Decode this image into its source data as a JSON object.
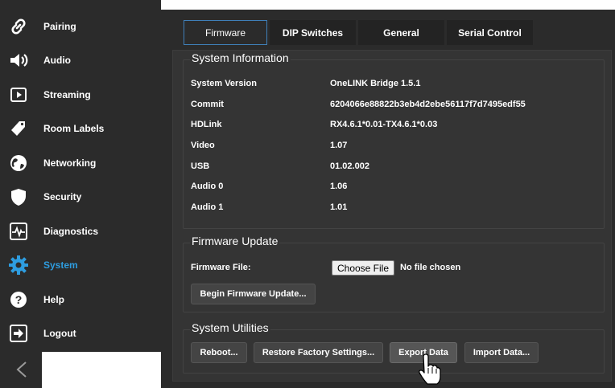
{
  "sidebar": {
    "items": [
      {
        "label": "Pairing",
        "icon": "link-icon"
      },
      {
        "label": "Audio",
        "icon": "speaker-icon"
      },
      {
        "label": "Streaming",
        "icon": "play-icon"
      },
      {
        "label": "Room Labels",
        "icon": "tag-icon"
      },
      {
        "label": "Networking",
        "icon": "globe-icon"
      },
      {
        "label": "Security",
        "icon": "shield-icon"
      },
      {
        "label": "Diagnostics",
        "icon": "pulse-icon"
      },
      {
        "label": "System",
        "icon": "gear-icon",
        "active": true
      },
      {
        "label": "Help",
        "icon": "help-icon"
      },
      {
        "label": "Logout",
        "icon": "logout-icon"
      }
    ],
    "collapse_icon": "chevron-left-icon"
  },
  "tabs": [
    {
      "label": "Firmware",
      "active": true
    },
    {
      "label": "DIP Switches"
    },
    {
      "label": "General"
    },
    {
      "label": "Serial Control"
    }
  ],
  "system_info": {
    "title": "System Information",
    "rows": [
      {
        "label": "System Version",
        "value": "OneLINK Bridge 1.5.1"
      },
      {
        "label": "Commit",
        "value": "6204066e88822b3eb4d2ebe56117f7d7495edf55"
      },
      {
        "label": "HDLink",
        "value": "RX4.6.1*0.01-TX4.6.1*0.03"
      },
      {
        "label": "Video",
        "value": "1.07"
      },
      {
        "label": "USB",
        "value": "01.02.002"
      },
      {
        "label": "Audio 0",
        "value": "1.06"
      },
      {
        "label": "Audio 1",
        "value": "1.01"
      }
    ]
  },
  "firmware_update": {
    "title": "Firmware Update",
    "file_label": "Firmware File:",
    "choose_button": "Choose File",
    "file_status": "No file chosen",
    "begin_button": "Begin Firmware Update..."
  },
  "utilities": {
    "title": "System Utilities",
    "buttons": [
      "Reboot...",
      "Restore Factory Settings...",
      "Export Data",
      "Import Data..."
    ]
  },
  "colors": {
    "accent": "#2e9de0",
    "sidebar_bg": "#2b2b2b",
    "panel_bg": "#343434"
  }
}
